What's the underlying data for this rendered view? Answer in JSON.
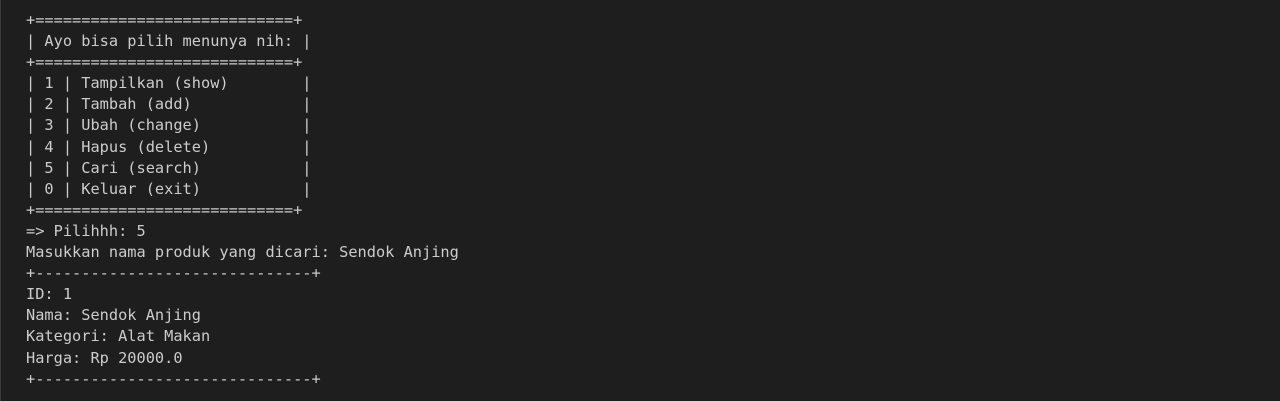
{
  "terminal": {
    "lines": [
      "+============================+",
      "| Ayo bisa pilih menunya nih: |",
      "+============================+",
      "| 1 | Tampilkan (show)        |",
      "| 2 | Tambah (add)            |",
      "| 3 | Ubah (change)           |",
      "| 4 | Hapus (delete)          |",
      "| 5 | Cari (search)           |",
      "| 0 | Keluar (exit)           |",
      "+============================+",
      "=> Pilihhh: 5",
      "Masukkan nama produk yang dicari: Sendok Anjing",
      "+------------------------------+",
      "ID: 1",
      "Nama: Sendok Anjing",
      "Kategori: Alat Makan",
      "Harga: Rp 20000.0",
      "+------------------------------+"
    ]
  },
  "colors": {
    "background": "#1e1e1e",
    "text": "#cccccc"
  }
}
